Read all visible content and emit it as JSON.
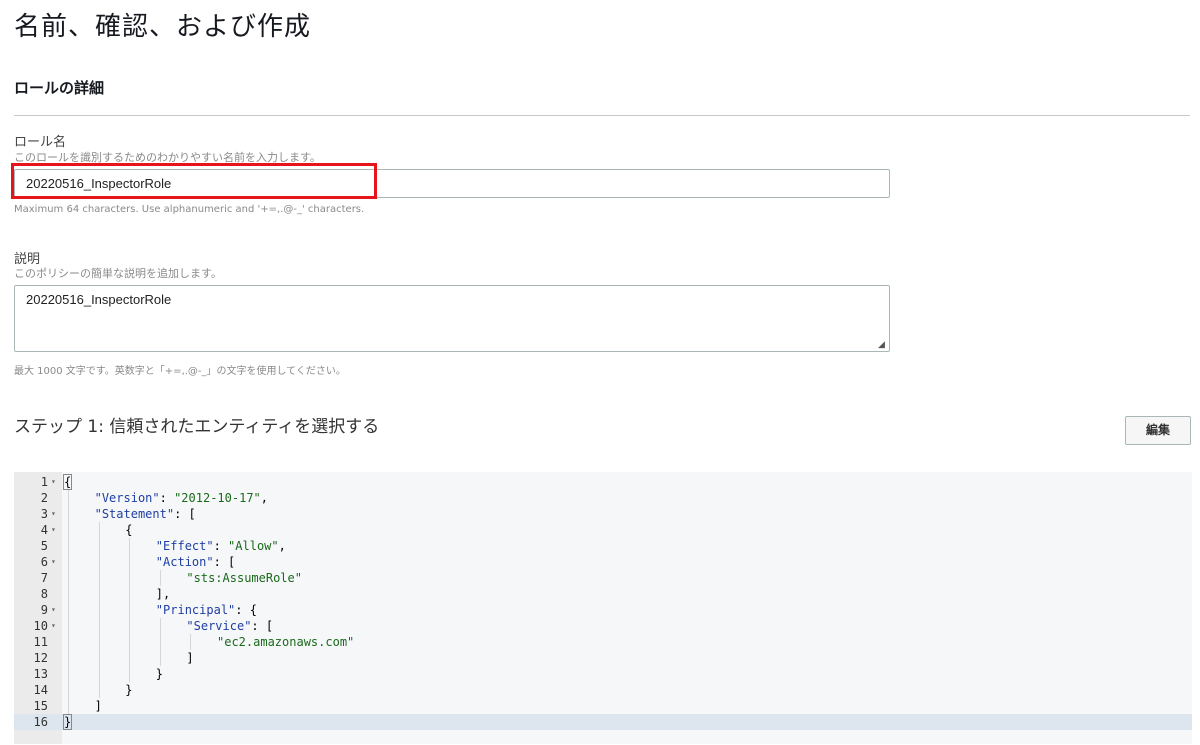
{
  "page_title": "名前、確認、および作成",
  "section_title": "ロールの詳細",
  "role_name": {
    "label": "ロール名",
    "description": "このロールを識別するためのわかりやすい名前を入力します。",
    "value": "20220516_InspectorRole",
    "hint": "Maximum 64 characters. Use alphanumeric and '+=,.@-_' characters."
  },
  "description_field": {
    "label": "説明",
    "description": "このポリシーの簡単な説明を追加します。",
    "value": "20220516_InspectorRole",
    "hint": "最大 1000 文字です。英数字と「+=,.@-_」の文字を使用してください。"
  },
  "step1": {
    "title": "ステップ 1: 信頼されたエンティティを選択する",
    "edit_label": "編集"
  },
  "code": {
    "lines": [
      {
        "n": "1",
        "fold": true,
        "indent": 0,
        "parts": [
          [
            "p",
            "{"
          ]
        ]
      },
      {
        "n": "2",
        "fold": false,
        "indent": 1,
        "parts": [
          [
            "k",
            "\"Version\""
          ],
          [
            "p",
            ": "
          ],
          [
            "s",
            "\"2012-10-17\""
          ],
          [
            "p",
            ","
          ]
        ]
      },
      {
        "n": "3",
        "fold": true,
        "indent": 1,
        "parts": [
          [
            "k",
            "\"Statement\""
          ],
          [
            "p",
            ": ["
          ]
        ]
      },
      {
        "n": "4",
        "fold": true,
        "indent": 2,
        "parts": [
          [
            "p",
            "{"
          ]
        ]
      },
      {
        "n": "5",
        "fold": false,
        "indent": 3,
        "parts": [
          [
            "k",
            "\"Effect\""
          ],
          [
            "p",
            ": "
          ],
          [
            "s",
            "\"Allow\""
          ],
          [
            "p",
            ","
          ]
        ]
      },
      {
        "n": "6",
        "fold": true,
        "indent": 3,
        "parts": [
          [
            "k",
            "\"Action\""
          ],
          [
            "p",
            ": ["
          ]
        ]
      },
      {
        "n": "7",
        "fold": false,
        "indent": 4,
        "parts": [
          [
            "s",
            "\"sts:AssumeRole\""
          ]
        ]
      },
      {
        "n": "8",
        "fold": false,
        "indent": 3,
        "parts": [
          [
            "p",
            "],"
          ]
        ]
      },
      {
        "n": "9",
        "fold": true,
        "indent": 3,
        "parts": [
          [
            "k",
            "\"Principal\""
          ],
          [
            "p",
            ": {"
          ]
        ]
      },
      {
        "n": "10",
        "fold": true,
        "indent": 4,
        "parts": [
          [
            "k",
            "\"Service\""
          ],
          [
            "p",
            ": ["
          ]
        ]
      },
      {
        "n": "11",
        "fold": false,
        "indent": 5,
        "parts": [
          [
            "s",
            "\"ec2.amazonaws.com\""
          ]
        ]
      },
      {
        "n": "12",
        "fold": false,
        "indent": 4,
        "parts": [
          [
            "p",
            "]"
          ]
        ]
      },
      {
        "n": "13",
        "fold": false,
        "indent": 3,
        "parts": [
          [
            "p",
            "}"
          ]
        ]
      },
      {
        "n": "14",
        "fold": false,
        "indent": 2,
        "parts": [
          [
            "p",
            "}"
          ]
        ]
      },
      {
        "n": "15",
        "fold": false,
        "indent": 1,
        "parts": [
          [
            "p",
            "]"
          ]
        ]
      },
      {
        "n": "16",
        "fold": false,
        "indent": 0,
        "active": true,
        "parts": [
          [
            "p",
            "}"
          ]
        ]
      }
    ]
  }
}
